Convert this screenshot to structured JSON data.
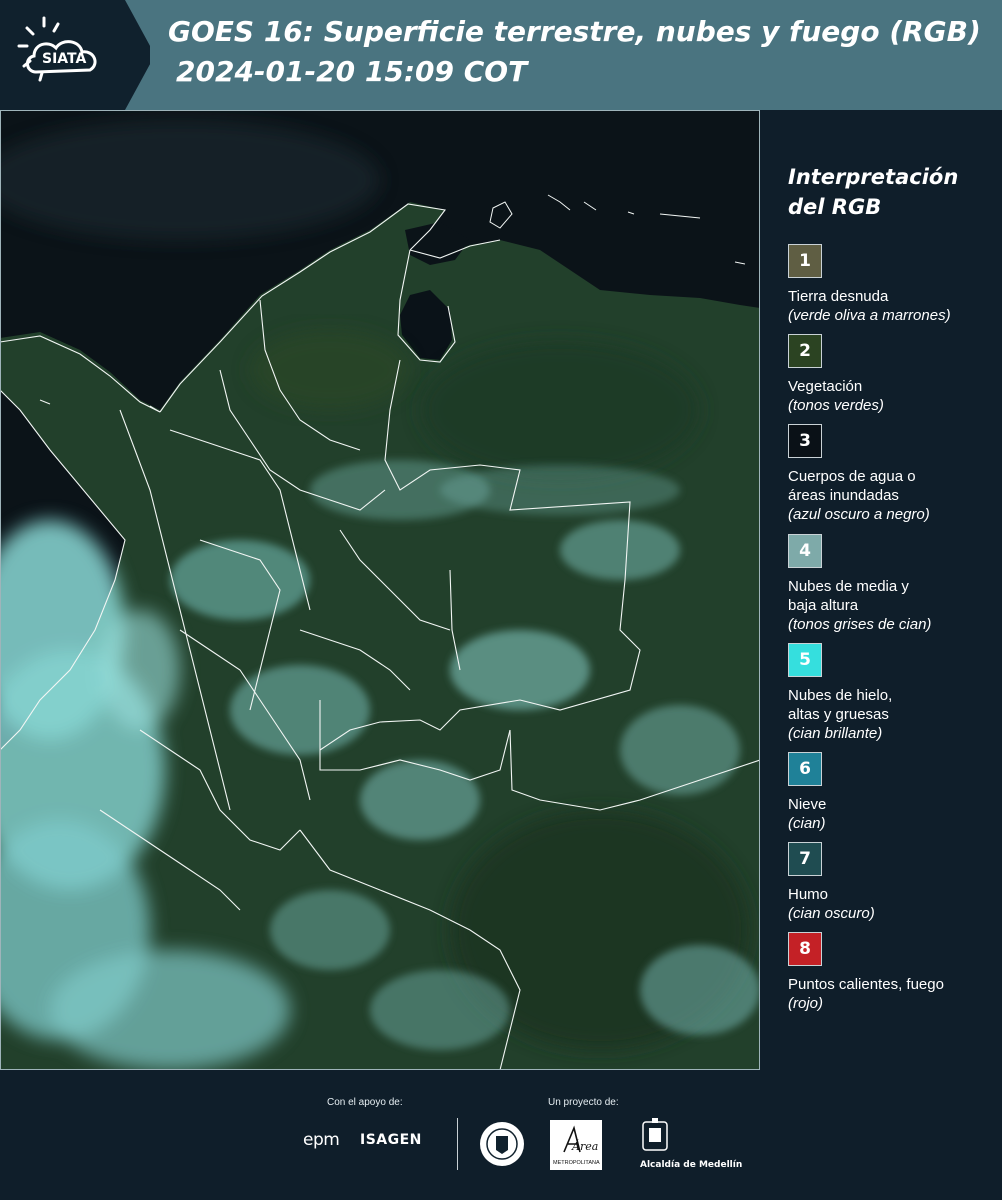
{
  "header": {
    "logo_text": "SIATA",
    "title_line1": "GOES 16: Superficie terrestre, nubes y fuego (RGB)",
    "title_line2": "2024-01-20 15:09 COT"
  },
  "legend": {
    "title": "Interpretación del RGB",
    "items": [
      {
        "number": "1",
        "color": "#5f5e43",
        "label": "Tierra desnuda",
        "sub": "(verde oliva a marrones)"
      },
      {
        "number": "2",
        "color": "#2b4322",
        "label": "Vegetación",
        "sub": "(tonos verdes)"
      },
      {
        "number": "3",
        "color": "#0a1117",
        "label": "Cuerpos de agua o áreas inundadas",
        "sub": "(azul oscuro a negro)"
      },
      {
        "number": "4",
        "color": "#7eaaa9",
        "label": "Nubes de media y baja altura",
        "sub": "(tonos grises de cian)"
      },
      {
        "number": "5",
        "color": "#35dfde",
        "label": "Nubes de hielo, altas y gruesas",
        "sub": "(cian brillante)"
      },
      {
        "number": "6",
        "color": "#1f8198",
        "label": "Nieve",
        "sub": "(cian)"
      },
      {
        "number": "7",
        "color": "#1f4c51",
        "label": "Humo",
        "sub": "(cian oscuro)"
      },
      {
        "number": "8",
        "color": "#c42126",
        "label": "Puntos calientes, fuego",
        "sub": "(rojo)"
      }
    ]
  },
  "footer": {
    "support_label": "Con el apoyo de:",
    "project_label": "Un proyecto de:",
    "sponsor_1": "epm",
    "sponsor_2": "ISAGEN",
    "area_logo_text": "Área",
    "area_caption": "METROPOLITANA",
    "alcaldia": "Alcaldía de Medellín"
  },
  "colors": {
    "header_bg": "#4a7480",
    "panel_bg": "#0f1e2a",
    "ocean": "#0c1418",
    "vegetation": "#25422a",
    "cloud": "#8fe6e3"
  }
}
